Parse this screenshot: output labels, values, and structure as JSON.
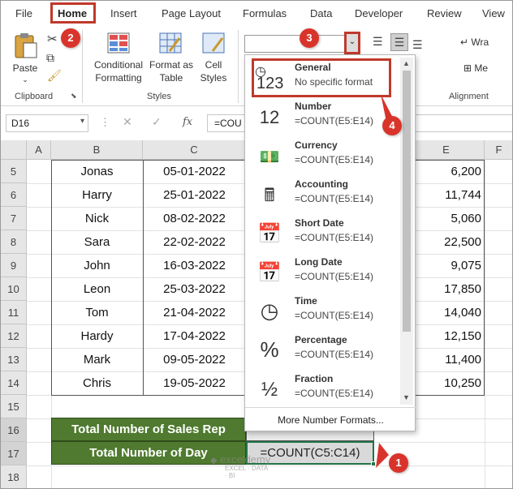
{
  "menu": {
    "tabs": [
      "File",
      "Home",
      "Insert",
      "Page Layout",
      "Formulas",
      "Data",
      "Developer",
      "Review",
      "View"
    ]
  },
  "ribbon": {
    "paste_label": "Paste",
    "conditional_formatting": [
      "Conditional",
      "Formatting"
    ],
    "format_as_table": [
      "Format as",
      "Table"
    ],
    "cell_styles": [
      "Cell",
      "Styles"
    ],
    "wrap_label": "Wra",
    "merge_label": "Me",
    "groups": {
      "clipboard": "Clipboard",
      "styles": "Styles",
      "alignment": "Alignment"
    }
  },
  "formula_bar": {
    "name_box": "D16",
    "fx_symbol": "fx",
    "formula": "=COU"
  },
  "columns": [
    "A",
    "B",
    "C",
    "E",
    "F"
  ],
  "rows": [
    {
      "num": "5",
      "name": "Jonas",
      "date": "05-01-2022",
      "value": "6,200"
    },
    {
      "num": "6",
      "name": "Harry",
      "date": "25-01-2022",
      "value": "11,744"
    },
    {
      "num": "7",
      "name": "Nick",
      "date": "08-02-2022",
      "value": "5,060"
    },
    {
      "num": "8",
      "name": "Sara",
      "date": "22-02-2022",
      "value": "22,500"
    },
    {
      "num": "9",
      "name": "John",
      "date": "16-03-2022",
      "value": "9,075"
    },
    {
      "num": "10",
      "name": "Leon",
      "date": "25-03-2022",
      "value": "17,850"
    },
    {
      "num": "11",
      "name": "Tom",
      "date": "21-04-2022",
      "value": "14,040"
    },
    {
      "num": "12",
      "name": "Hardy",
      "date": "17-04-2022",
      "value": "12,150"
    },
    {
      "num": "13",
      "name": "Mark",
      "date": "09-05-2022",
      "value": "11,400"
    },
    {
      "num": "14",
      "name": "Chris",
      "date": "19-05-2022",
      "value": "10,250"
    }
  ],
  "extra_rows": [
    "15",
    "16",
    "17",
    "18"
  ],
  "summary": {
    "sales_rep_label": "Total Number of Sales Rep",
    "day_label": "Total Number of Day",
    "day_formula": "=COUNT(C5:C14)"
  },
  "number_format_dropdown": {
    "items": [
      {
        "title": "General",
        "sub": "No specific format",
        "icon": "general-123-icon"
      },
      {
        "title": "Number",
        "sub": "=COUNT(E5:E14)",
        "icon": "number-12-icon"
      },
      {
        "title": "Currency",
        "sub": "=COUNT(E5:E14)",
        "icon": "currency-icon"
      },
      {
        "title": "Accounting",
        "sub": "=COUNT(E5:E14)",
        "icon": "accounting-icon"
      },
      {
        "title": "Short Date",
        "sub": "=COUNT(E5:E14)",
        "icon": "short-date-icon"
      },
      {
        "title": "Long Date",
        "sub": "=COUNT(E5:E14)",
        "icon": "long-date-icon"
      },
      {
        "title": "Time",
        "sub": "=COUNT(E5:E14)",
        "icon": "clock-icon"
      },
      {
        "title": "Percentage",
        "sub": "=COUNT(E5:E14)",
        "icon": "percent-icon"
      },
      {
        "title": "Fraction",
        "sub": "=COUNT(E5:E14)",
        "icon": "fraction-icon"
      }
    ],
    "more": "More Number Formats..."
  },
  "badges": [
    "1",
    "2",
    "3",
    "4"
  ],
  "watermark": "exceldemy",
  "watermark_sub": "EXCEL · DATA · BI",
  "colors": {
    "header_bg": "#4f7a2f",
    "badge": "#d9342b",
    "highlight": "#c0392b"
  }
}
